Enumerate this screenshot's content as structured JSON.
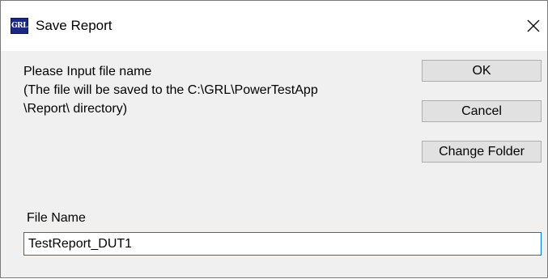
{
  "window": {
    "title": "Save Report",
    "icon_text": "GRL",
    "icon_color": "#1b2a80"
  },
  "message": {
    "line1": "Please Input file name",
    "line2": "(The file will be saved to the C:\\GRL\\PowerTestApp",
    "line3": "\\Report\\ directory)"
  },
  "buttons": {
    "ok": "OK",
    "cancel": "Cancel",
    "change_folder": "Change Folder"
  },
  "file_name": {
    "label": "File Name",
    "value": "TestReport_DUT1"
  },
  "colors": {
    "focus_border": "#0078d7",
    "button_face": "#e1e1e1",
    "dialog_background": "#f0f0f0"
  }
}
